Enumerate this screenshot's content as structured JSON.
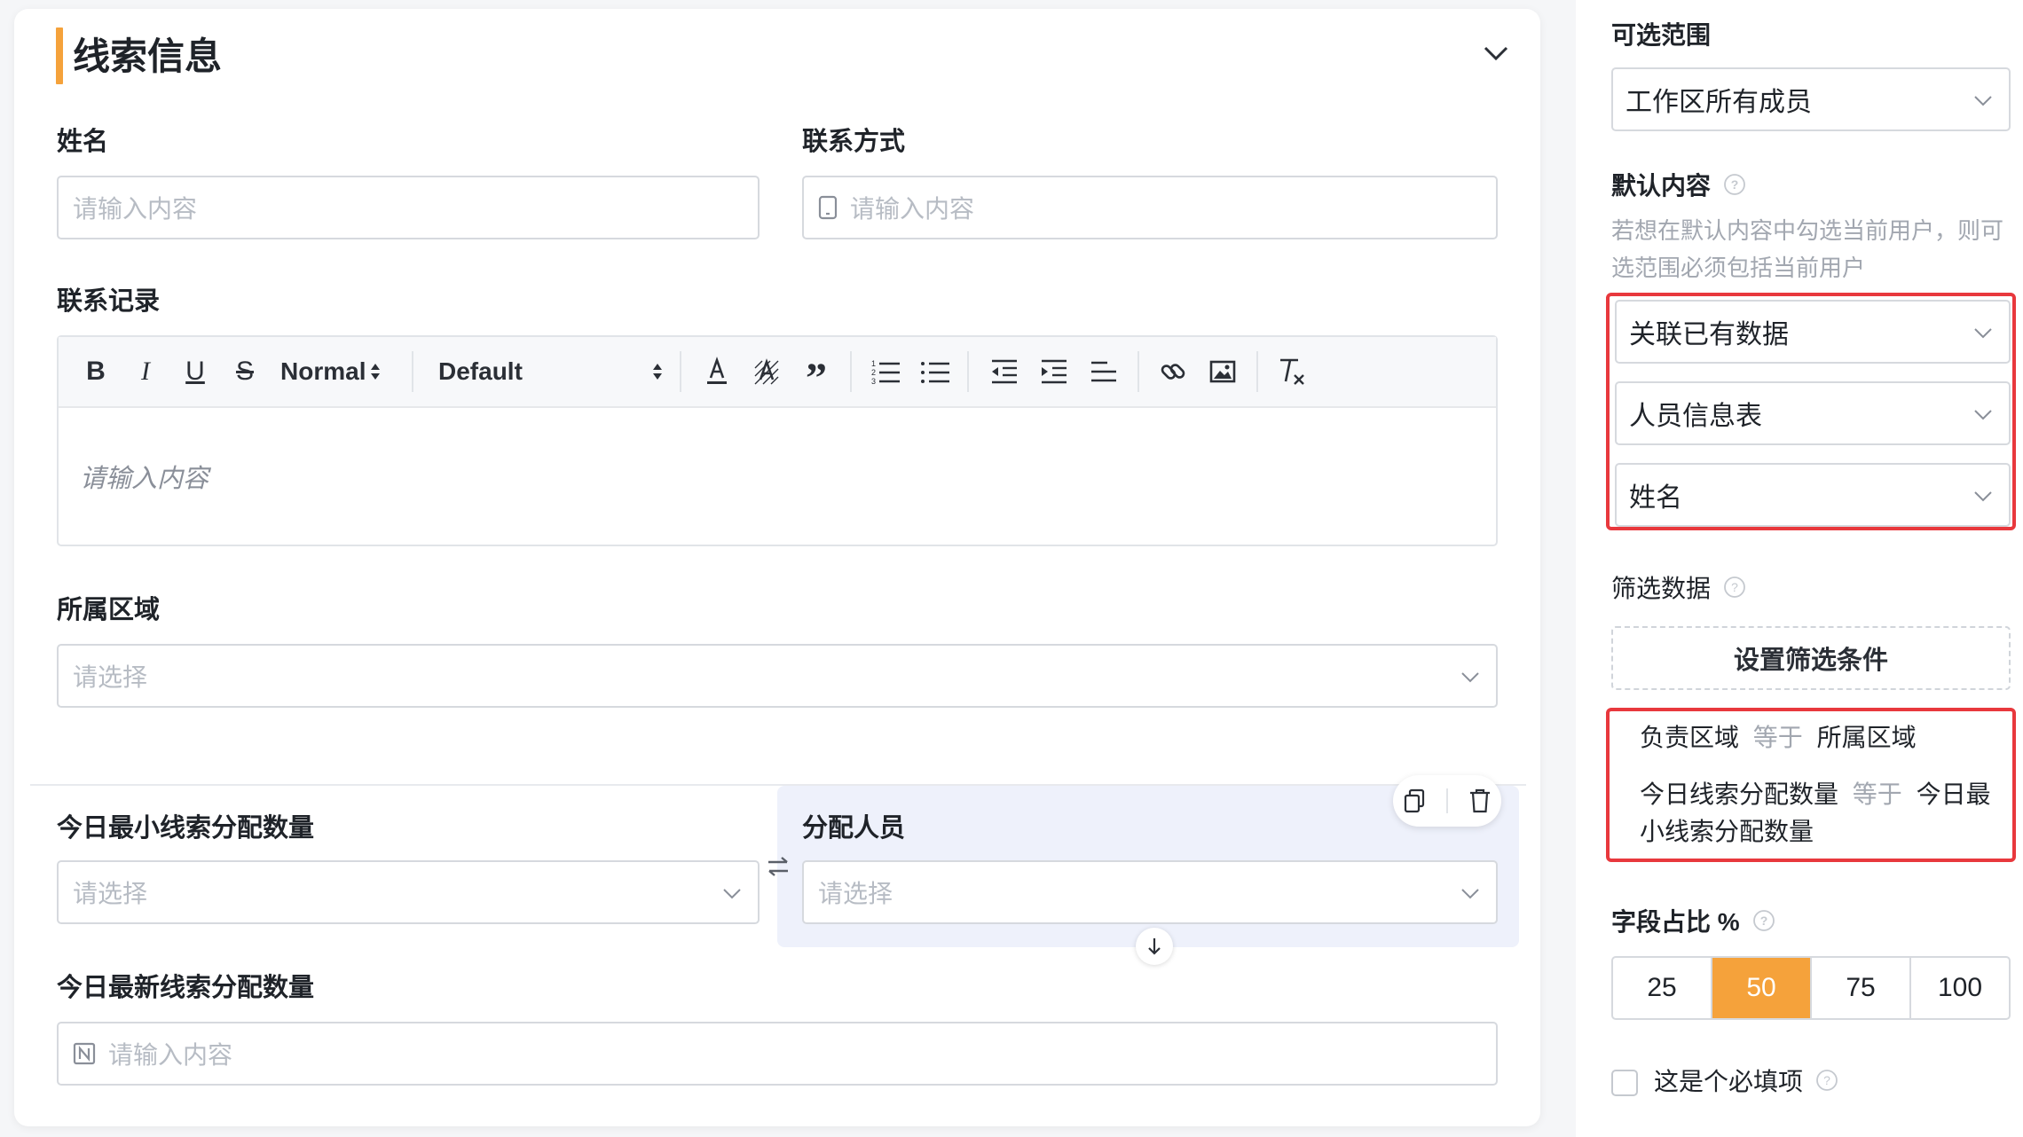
{
  "section": {
    "title": "线索信息"
  },
  "fields": {
    "name": {
      "label": "姓名",
      "placeholder": "请输入内容"
    },
    "contact": {
      "label": "联系方式",
      "placeholder": "请输入内容"
    },
    "record": {
      "label": "联系记录",
      "placeholder": "请输入内容",
      "toolbar": {
        "header_select": "Normal",
        "font_select": "Default"
      }
    },
    "region": {
      "label": "所属区域",
      "placeholder": "请选择"
    },
    "min_count": {
      "label": "今日最小线索分配数量",
      "placeholder": "请选择"
    },
    "assignee": {
      "label": "分配人员",
      "placeholder": "请选择"
    },
    "latest_count": {
      "label": "今日最新线索分配数量",
      "placeholder": "请输入内容"
    }
  },
  "panel": {
    "scope": {
      "label": "可选范围",
      "value": "工作区所有成员"
    },
    "default": {
      "label": "默认内容",
      "hint_line1": "若想在默认内容中勾选当前用户，则可",
      "hint_line2": "选范围必须包括当前用户",
      "selects": [
        "关联已有数据",
        "人员信息表",
        "姓名"
      ]
    },
    "filter": {
      "label": "筛选数据",
      "button": "设置筛选条件",
      "conditions": [
        {
          "field": "负责区域",
          "op": "等于",
          "value": "所属区域"
        },
        {
          "field": "今日线索分配数量",
          "op": "等于",
          "value": "今日最",
          "value_cont": "小线索分配数量"
        }
      ]
    },
    "width": {
      "label": "字段占比 %",
      "options": [
        "25",
        "50",
        "75",
        "100"
      ],
      "selected": "50"
    },
    "required": {
      "label": "这是个必填项"
    }
  },
  "colors": {
    "accent": "#f5a23b",
    "highlight": "#e8383d",
    "active_bg": "#eef1fb"
  }
}
